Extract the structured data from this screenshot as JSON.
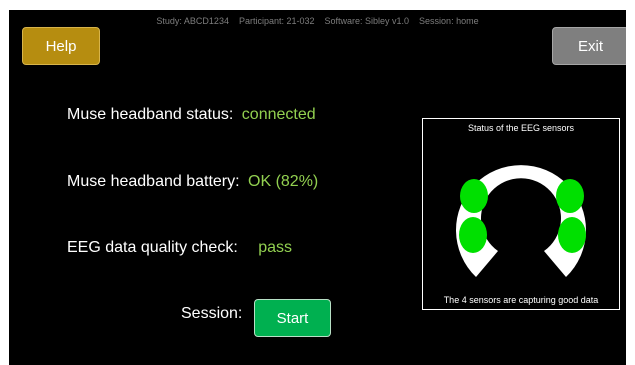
{
  "header": {
    "session_info": "Study: ABCD1234    Participant: 21-032    Software: Sibley v1.0    Session: home"
  },
  "buttons": {
    "help": "Help",
    "exit": "Exit",
    "start": "Start"
  },
  "status": {
    "headband_label": "Muse headband status:",
    "headband_value": "connected",
    "battery_label": "Muse headband battery:",
    "battery_value": "OK (82%)",
    "quality_label": "EEG data quality check:",
    "quality_value": "pass"
  },
  "session": {
    "label": "Session:"
  },
  "eeg_panel": {
    "title": "Status of the EEG sensors",
    "caption": "The 4 sensors are capturing good data",
    "sensor_color": "#00e000",
    "headband_color": "#ffffff"
  },
  "colors": {
    "help_button": "#b68d10",
    "exit_button": "#7f7f7f",
    "start_button": "#00b050",
    "status_value": "#92d050"
  }
}
